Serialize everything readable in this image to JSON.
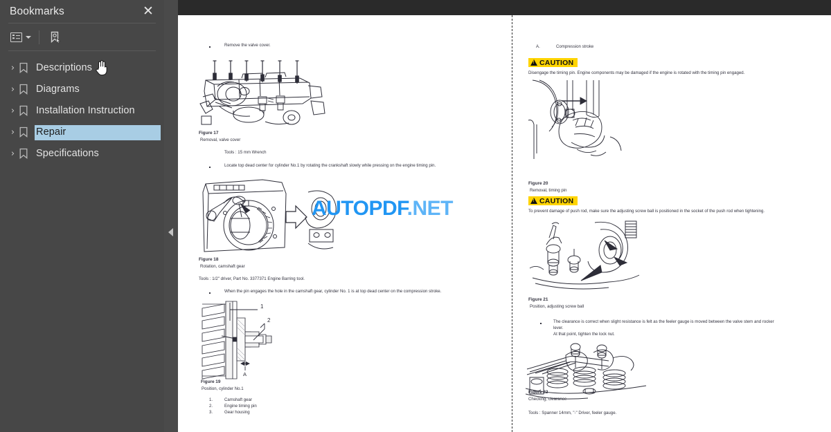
{
  "sidebar": {
    "title": "Bookmarks",
    "close_icon": "close-icon",
    "toolbar": {
      "options_icon": "list-options-icon",
      "caret_icon": "chevron-down-icon",
      "new_bookmark_icon": "new-bookmark-icon"
    },
    "items": [
      {
        "label": "Descriptions",
        "expander": "›",
        "selected": false
      },
      {
        "label": "Diagrams",
        "expander": "›",
        "selected": false
      },
      {
        "label": "Installation Instruction",
        "expander": "›",
        "selected": false
      },
      {
        "label": "Repair",
        "expander": "›",
        "selected": true
      },
      {
        "label": "Specifications",
        "expander": "›",
        "selected": false
      }
    ]
  },
  "splitter": {
    "collapse_icon": "collapse-left-arrow-icon"
  },
  "watermark": {
    "part1": "AUTOPDF",
    "part2": ".NET"
  },
  "document": {
    "left_page": {
      "b1": "Remove the valve cover.",
      "fig17_title": "Figure 17",
      "fig17_caption": "Removal, valve cover",
      "fig17_tools": "Tools : 15 mm Wrench",
      "b2": "Locate top dead center for cylinder No.1 by rotating the crankshaft slowly while pressing on the engine timing pin.",
      "fig18_title": "Figure 18",
      "fig18_caption": "Rotation, camshaft gear",
      "fig18_tools": "Tools : 1/2\" driver, Part No. 3377371 Engine Barring tool.",
      "b3": "When the pin engages the hole in the camshaft gear, cylinder No. 1 is at top dead center on the compression stroke.",
      "fig19_title": "Figure 19",
      "fig19_caption": "Position, cylinder No.1",
      "legend": [
        {
          "num": "1.",
          "text": "Camshaft gear"
        },
        {
          "num": "2.",
          "text": "Engine timing pin"
        },
        {
          "num": "3.",
          "text": "Gear housing"
        }
      ]
    },
    "right_page": {
      "item_a_num": "A.",
      "item_a_text": "Compression stroke",
      "caution1_label": "CAUTION",
      "caution1_text": "Disengage the timing pin. Engine components may be damaged if the engine is rotated with the timing pin engaged.",
      "fig20_title": "Figure 20",
      "fig20_caption": "Removal, timing pin",
      "caution2_label": "CAUTION",
      "caution2_text": "To prevent damage of push rod, make sure the adjusting screw ball is positioned in the socket of the push rod when tightening.",
      "fig21_title": "Figure 21",
      "fig21_caption": "Position, adjusting screw ball",
      "b4_line1": "The clearance is correct when slight resistance is felt as the feeler gauge is moved between the valve stem and rocker",
      "b4_line2": "lever.",
      "b4_line3": "At that point, tighten the lock nut.",
      "fig22_title": "Figure 22",
      "fig22_caption": "Checking, clearance",
      "fig22_tools": "Tools : Spanner 14mm, \"-\" Driver, feeler gauge."
    }
  },
  "colors": {
    "sidebar_bg": "#474747",
    "selection": "#a8cde4",
    "caution_yellow": "#ffd400",
    "watermark_primary": "#2196f3",
    "watermark_secondary": "#5eb4f7",
    "page_bg": "#ffffff",
    "topbar_bg": "#2a2a2a"
  }
}
